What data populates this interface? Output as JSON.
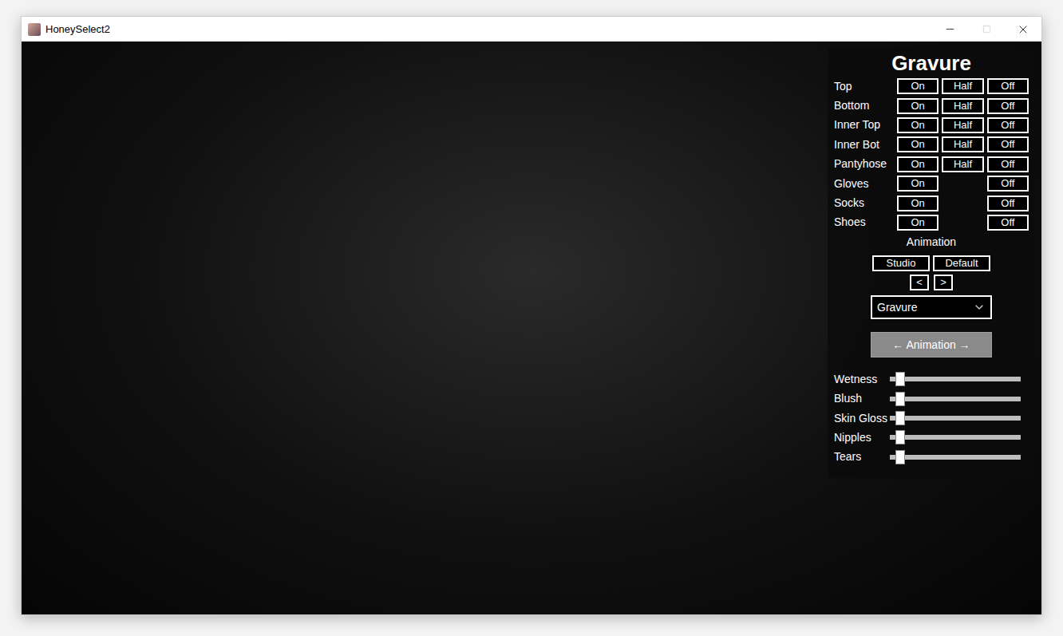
{
  "window": {
    "title": "HoneySelect2"
  },
  "panel": {
    "title": "Gravure",
    "clothing": [
      {
        "label": "Top",
        "has_half": true,
        "buttons": [
          "On",
          "Half",
          "Off"
        ]
      },
      {
        "label": "Bottom",
        "has_half": true,
        "buttons": [
          "On",
          "Half",
          "Off"
        ]
      },
      {
        "label": "Inner Top",
        "has_half": true,
        "buttons": [
          "On",
          "Half",
          "Off"
        ]
      },
      {
        "label": "Inner Bot",
        "has_half": true,
        "buttons": [
          "On",
          "Half",
          "Off"
        ]
      },
      {
        "label": "Pantyhose",
        "has_half": true,
        "buttons": [
          "On",
          "Half",
          "Off"
        ]
      },
      {
        "label": "Gloves",
        "has_half": false,
        "buttons": [
          "On",
          "Off"
        ]
      },
      {
        "label": "Socks",
        "has_half": false,
        "buttons": [
          "On",
          "Off"
        ]
      },
      {
        "label": "Shoes",
        "has_half": false,
        "buttons": [
          "On",
          "Off"
        ]
      }
    ],
    "animation": {
      "label": "Animation",
      "modes": [
        "Studio",
        "Default"
      ],
      "prev": "<",
      "next": ">",
      "dropdown": {
        "value": "Gravure"
      },
      "button": "← Animation →"
    },
    "sliders": [
      {
        "label": "Wetness",
        "level": 0.08
      },
      {
        "label": "Blush",
        "level": 0.08
      },
      {
        "label": "Skin Gloss",
        "level": 0.08
      },
      {
        "label": "Nipples",
        "level": 0.08
      },
      {
        "label": "Tears",
        "level": 0.08
      }
    ]
  }
}
